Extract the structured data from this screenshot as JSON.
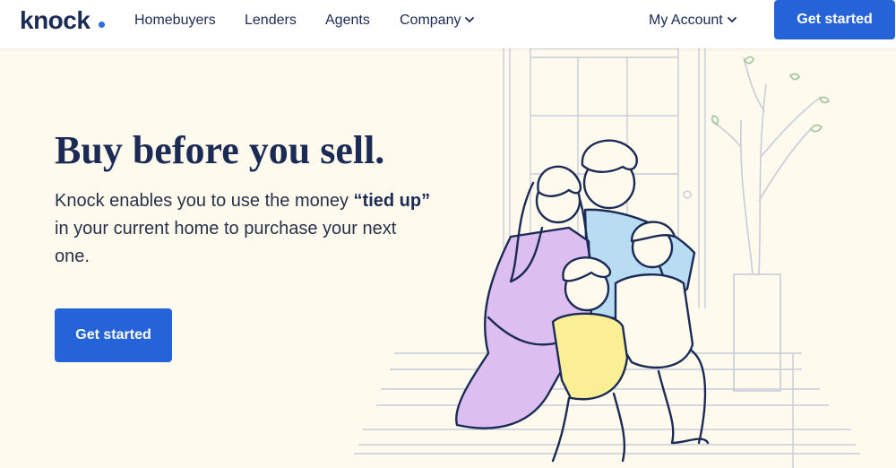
{
  "nav": {
    "logo": "knock",
    "links": [
      "Homebuyers",
      "Lenders",
      "Agents",
      "Company"
    ],
    "account": "My Account",
    "cta": "Get started"
  },
  "hero": {
    "title": "Buy before you sell.",
    "desc_before": "Knock enables you to use the money ",
    "desc_bold": "“tied up”",
    "desc_after": " in your current home to purchase your next one.",
    "cta": "Get started"
  },
  "colors": {
    "brand_blue": "#2563d9",
    "navy": "#1b2b55",
    "background": "#fefbee",
    "dress_purple": "#dcbff0",
    "shirt_blue": "#b8ddf3",
    "shirt_yellow": "#fbef96"
  },
  "icons": [
    "chevron-down-icon",
    "logo-dot"
  ]
}
